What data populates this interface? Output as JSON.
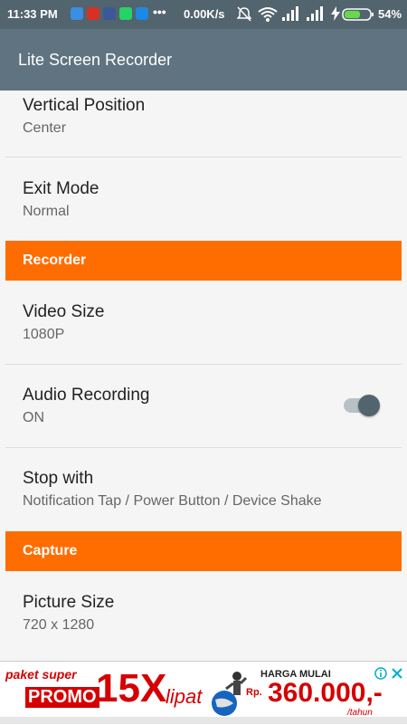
{
  "status_bar": {
    "time": "11:33 PM",
    "network_speed": "0.00K/s",
    "battery": "54%",
    "notification_icons": [
      "bbm-icon",
      "mail-icon",
      "facebook-icon",
      "whatsapp-icon",
      "messenger-icon",
      "more-icon"
    ]
  },
  "app_bar": {
    "title": "Lite Screen Recorder"
  },
  "settings": {
    "vertical_position": {
      "title": "Vertical Position",
      "summary": "Center"
    },
    "exit_mode": {
      "title": "Exit Mode",
      "summary": "Normal"
    },
    "recorder_header": "Recorder",
    "video_size": {
      "title": "Video Size",
      "summary": "1080P"
    },
    "audio_recording": {
      "title": "Audio Recording",
      "summary": "ON",
      "toggle_on": true
    },
    "stop_with": {
      "title": "Stop with",
      "summary": "Notification Tap / Power Button / Device Shake"
    },
    "capture_header": "Capture",
    "picture_size": {
      "title": "Picture Size",
      "summary": "720 x 1280"
    }
  },
  "ad": {
    "line1": "paket super",
    "promo": "PROMO",
    "big": "15X",
    "lipat": "lipat",
    "harga": "HARGA MULAI",
    "rp": "Rp.",
    "price": "360.000,-",
    "per": "/tahun"
  },
  "colors": {
    "status_bar": "#52646d",
    "app_bar": "#5f7480",
    "accent": "#ff6d00",
    "toggle_thumb": "#52646d"
  }
}
